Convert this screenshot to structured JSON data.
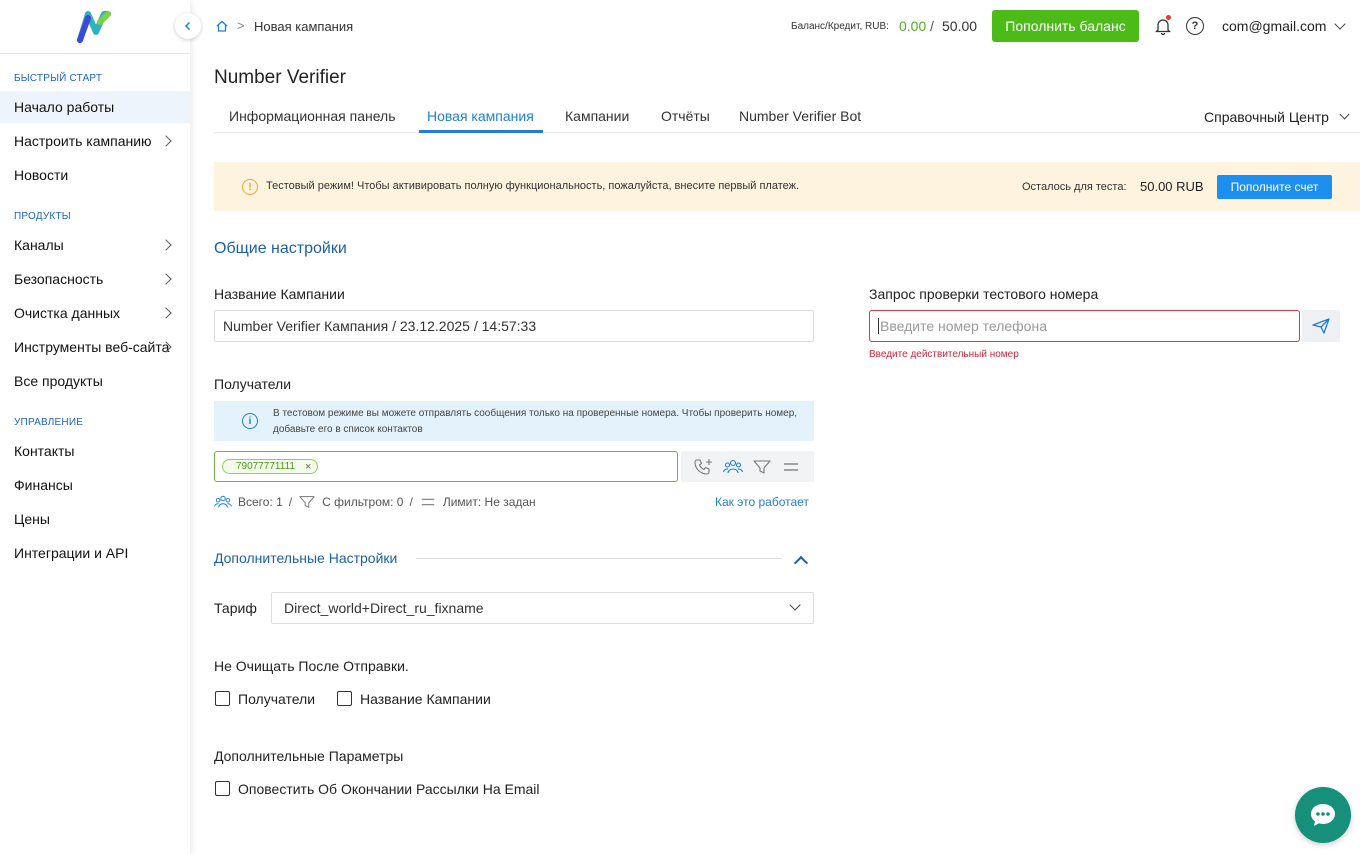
{
  "colors": {
    "accent": "#1d7fd6",
    "success": "#4cbb17",
    "warning_bg": "#fdf3de",
    "error": "#e0344a",
    "chat": "#17907b"
  },
  "sidebar": {
    "logo_icon": "app-logo-icon",
    "collapse_icon": "chevron-left-icon",
    "sections": [
      {
        "title": "БЫСТРЫЙ СТАРТ",
        "items": [
          {
            "label": "Начало работы",
            "active": true,
            "chevron": false
          },
          {
            "label": "Настроить кампанию",
            "active": false,
            "chevron": true
          },
          {
            "label": "Новости",
            "active": false,
            "chevron": false
          }
        ]
      },
      {
        "title": "ПРОДУКТЫ",
        "items": [
          {
            "label": "Каналы",
            "active": false,
            "chevron": true
          },
          {
            "label": "Безопасность",
            "active": false,
            "chevron": true
          },
          {
            "label": "Очистка данных",
            "active": false,
            "chevron": true
          },
          {
            "label": "Инструменты веб-сайта",
            "active": false,
            "chevron": true
          },
          {
            "label": "Все продукты",
            "active": false,
            "chevron": false
          }
        ]
      },
      {
        "title": "УПРАВЛЕНИЕ",
        "items": [
          {
            "label": "Контакты",
            "active": false,
            "chevron": false
          },
          {
            "label": "Финансы",
            "active": false,
            "chevron": false
          },
          {
            "label": "Цены",
            "active": false,
            "chevron": false
          },
          {
            "label": "Интеграции и API",
            "active": false,
            "chevron": false
          }
        ]
      }
    ]
  },
  "header": {
    "breadcrumb_home_icon": "home-icon",
    "breadcrumb_sep": ">",
    "breadcrumb_current": "Новая кампания",
    "balance_label": "Баланс/Кредит, RUB:",
    "balance_value": "0.00",
    "balance_slash": "/",
    "balance_limit": "50.00",
    "topup_label": "Пополнить баланс",
    "bell_icon": "bell-icon",
    "help_icon": "help-circle-icon",
    "help_glyph": "?",
    "account_email": "com@gmail.com"
  },
  "page": {
    "title": "Number Verifier",
    "tabs": [
      {
        "label": "Информационная панель",
        "active": false
      },
      {
        "label": "Новая кампания",
        "active": true
      },
      {
        "label": "Кампании",
        "active": false
      },
      {
        "label": "Отчёты",
        "active": false
      },
      {
        "label": "Number Verifier Bot",
        "active": false
      }
    ],
    "help_center": "Справочный Центр"
  },
  "banner": {
    "icon": "warning-icon",
    "icon_glyph": "!",
    "text": "Тестовый режим! Чтобы активировать полную функциональность, пожалуйста, внесите первый платеж.",
    "remain_label": "Осталось для теста:",
    "remain_value": "50.00 RUB",
    "pay_label": "Пополните счет"
  },
  "form": {
    "section_title": "Общие настройки",
    "campaign_name_label": "Название Кампании",
    "campaign_name_value": "Number Verifier Кампания / 23.12.2025 / 14:57:33",
    "test_request_label": "Запрос проверки тестового номера",
    "phone_placeholder": "Введите номер телефона",
    "phone_error": "Введите действительный номер",
    "send_icon": "send-icon",
    "recipients_label": "Получатели",
    "recipients_info_icon": "info-icon",
    "recipients_info_glyph": "i",
    "recipients_info": "В тестовом режиме вы можете отправлять сообщения только на проверенные номера. Чтобы проверить номер, добавьте его в список контактов",
    "recipient_chips": [
      "79077771111"
    ],
    "chip_remove_glyph": "×",
    "tool_icons": [
      "phone-add-icon",
      "contacts-icon",
      "filter-icon",
      "limit-icon"
    ],
    "stats": {
      "total_label": "Всего: 1",
      "filter_label": "С фильтром: 0",
      "limit_label": "Лимит: Не задан",
      "sep": "/"
    },
    "how_it_works": "Как это работает",
    "advanced_title": "Дополнительные Настройки",
    "tariff_label": "Тариф",
    "tariff_value": "Direct_world+Direct_ru_fixname",
    "keep_title": "Не Очищать После Отправки.",
    "keep_recipients": "Получатели",
    "keep_campaign_name": "Название Кампании",
    "extra_title": "Дополнительные Параметры",
    "notify_email": "Оповестить Об Окончании Рассылки На Email"
  },
  "chat": {
    "icon": "chat-bubble-icon"
  }
}
